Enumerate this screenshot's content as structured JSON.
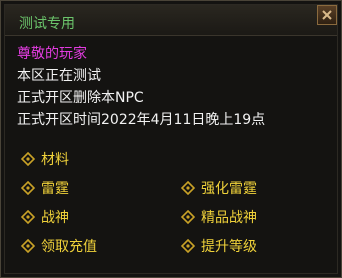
{
  "dialog": {
    "title": "测试专用",
    "close_icon": "close-icon"
  },
  "npc": {
    "speaker": "尊敬的玩家",
    "lines": [
      "本区正在测试",
      "正式开区删除本NPC",
      "正式开区时间2022年4月11日晚上19点"
    ]
  },
  "options": {
    "material": "材料",
    "leiting": "雷霆",
    "qianghua_leiting": "强化雷霆",
    "zhanshen": "战神",
    "jingpin_zhanshen": "精品战神",
    "recharge": "领取充值",
    "upgrade": "提升等级"
  },
  "colors": {
    "title": "#6bc46b",
    "speaker": "#e23ce0",
    "text": "#f2f2f2",
    "option": "#f0d23a",
    "option_icon": "#c9a227"
  },
  "option_icon": "diamond-bullet-icon"
}
